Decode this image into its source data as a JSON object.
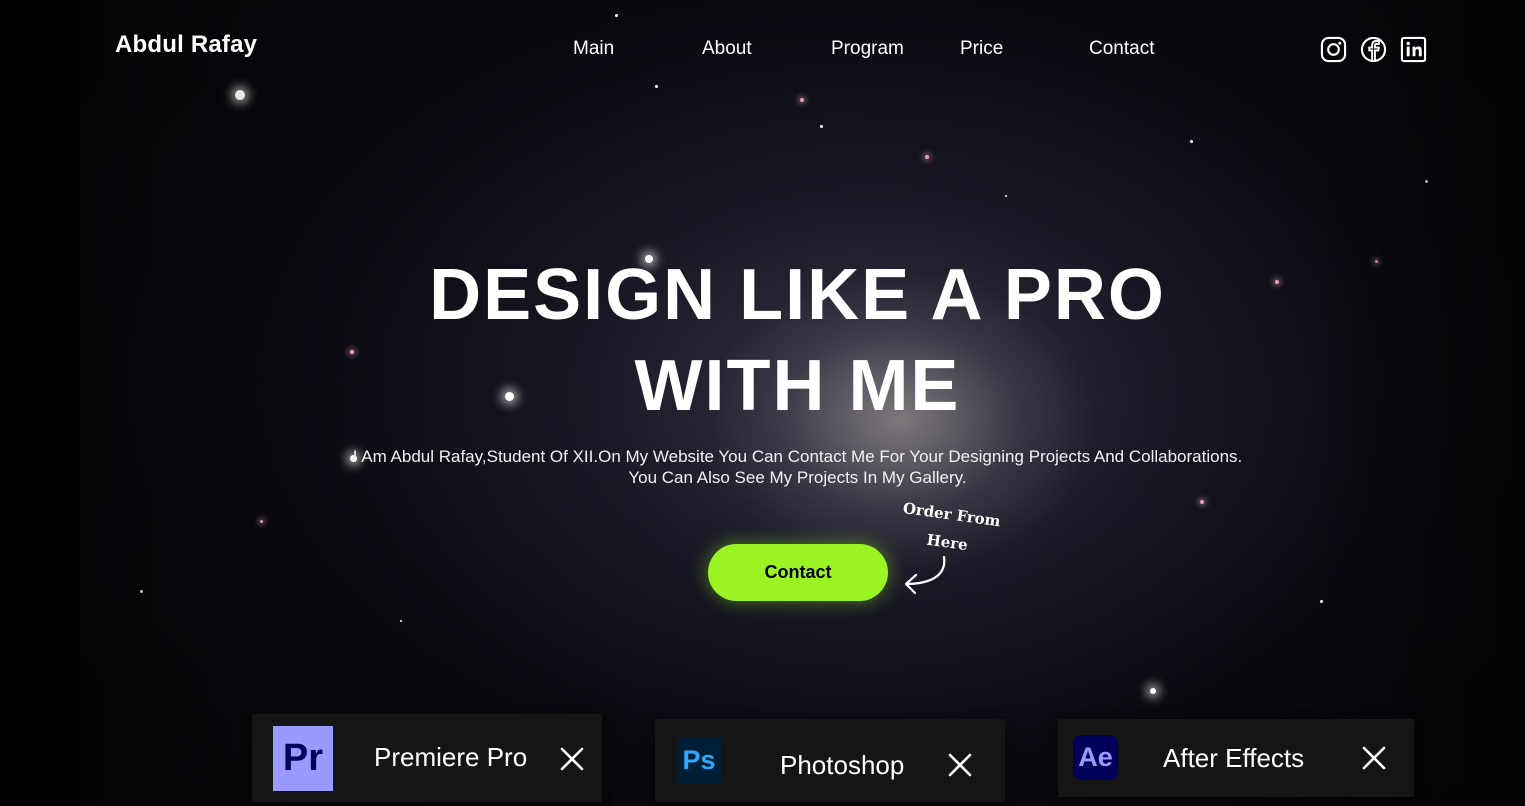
{
  "header": {
    "brand": "Abdul Rafay",
    "nav": [
      {
        "label": "Main"
      },
      {
        "label": "About"
      },
      {
        "label": "Program"
      },
      {
        "label": "Price"
      },
      {
        "label": "Contact"
      }
    ],
    "social": [
      "instagram-icon",
      "facebook-icon",
      "linkedin-icon"
    ]
  },
  "hero": {
    "headline_line1": "DESIGN LIKE A PRO",
    "headline_line2": "WITH ME",
    "intro_line1": "I Am Abdul Rafay,Student Of XII.On My Website You Can Contact Me For Your Designing Projects And Collaborations.",
    "intro_line2": "You Can Also See My Projects In My Gallery.",
    "cta_label": "Contact",
    "note_line1": "Order From",
    "note_line2": "Here"
  },
  "tools": [
    {
      "logo": "Pr",
      "name": "Premiere Pro",
      "logo_bg": "#9999ff",
      "logo_fg": "#00005b"
    },
    {
      "logo": "Ps",
      "name": "Photoshop",
      "logo_bg": "#001e36",
      "logo_fg": "#31a8ff"
    },
    {
      "logo": "Ae",
      "name": "After Effects",
      "logo_bg": "#00005b",
      "logo_fg": "#9999ff"
    }
  ],
  "colors": {
    "accent": "#9cf324",
    "background": "#000000",
    "text": "#ffffff"
  }
}
